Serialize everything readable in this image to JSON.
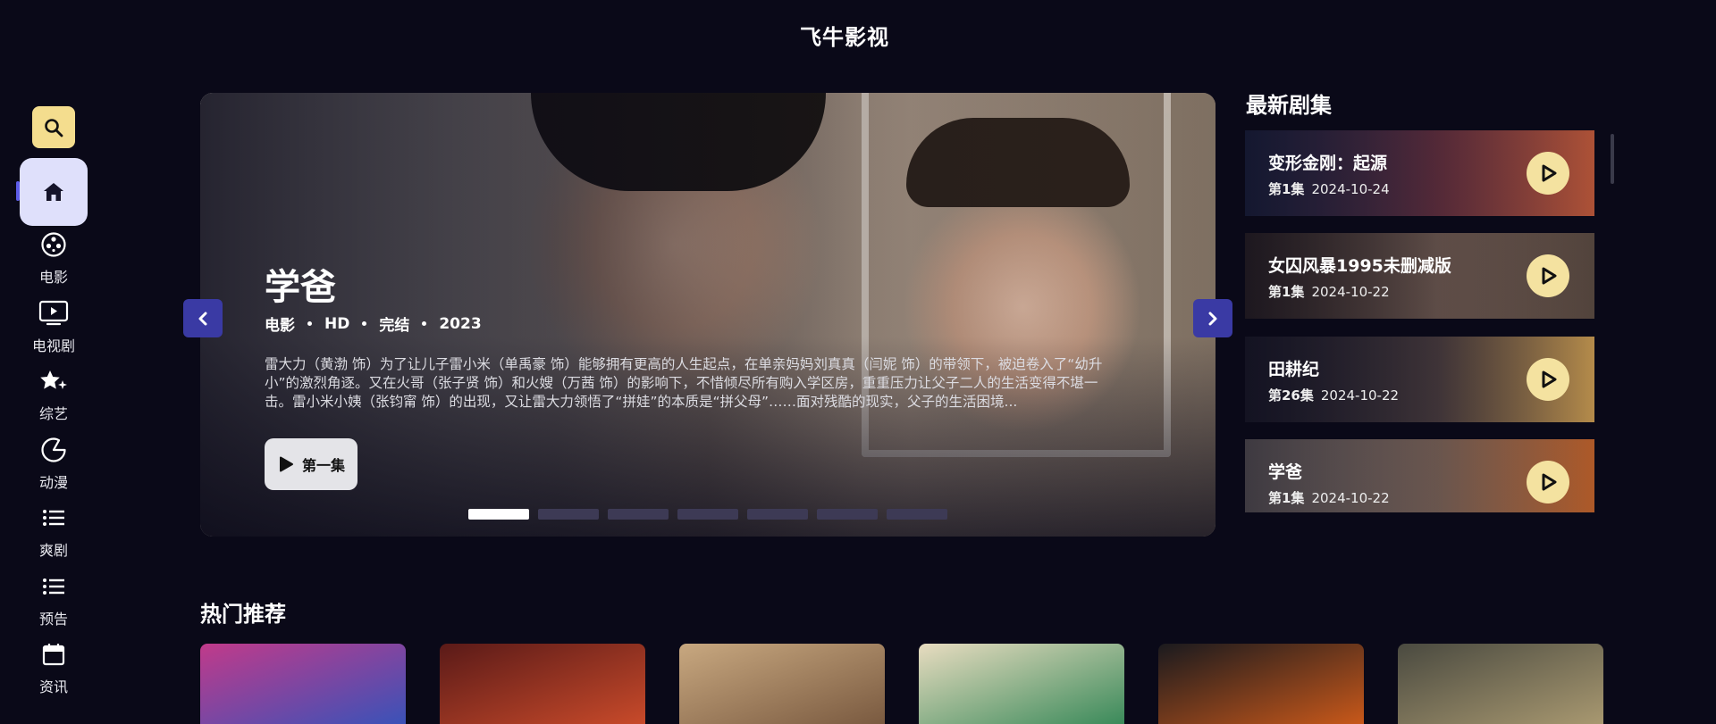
{
  "app": {
    "title": "飞牛影视"
  },
  "sidebar": {
    "search_icon": "search-icon",
    "items": [
      {
        "id": "home",
        "label": "",
        "icon": "home-icon",
        "active": true
      },
      {
        "id": "movie",
        "label": "电影",
        "icon": "film-reel-icon"
      },
      {
        "id": "tv",
        "label": "电视剧",
        "icon": "tv-icon"
      },
      {
        "id": "variety",
        "label": "综艺",
        "icon": "star-sparkle-icon"
      },
      {
        "id": "anime",
        "label": "动漫",
        "icon": "pacman-icon"
      },
      {
        "id": "short",
        "label": "爽剧",
        "icon": "list-icon"
      },
      {
        "id": "trailer",
        "label": "预告",
        "icon": "list-icon"
      },
      {
        "id": "news",
        "label": "资讯",
        "icon": "calendar-icon"
      }
    ]
  },
  "hero": {
    "title": "学爸",
    "meta": [
      "电影",
      "HD",
      "完结",
      "2023"
    ],
    "description": "雷大力（黄渤 饰）为了让儿子雷小米（单禹豪 饰）能够拥有更高的人生起点，在单亲妈妈刘真真（闫妮 饰）的带领下，被迫卷入了“幼升小”的激烈角逐。又在火哥（张子贤 饰）和火嫂（万茜 饰）的影响下，不惜倾尽所有购入学区房，重重压力让父子二人的生活变得不堪一击。雷小米小姨（张钧甯 饰）的出现，又让雷大力领悟了“拼娃”的本质是“拼父母”……面对残酷的现实，父子的生活困境...",
    "play_label": "第一集",
    "slides_total": 7,
    "active_slide": 1
  },
  "latest": {
    "title": "最新剧集",
    "items": [
      {
        "title": "变形金刚：起源",
        "episode": "第1集",
        "date": "2024-10-24",
        "colors": [
          "#2c3a68",
          "#7a3a48",
          "#c05a3a"
        ]
      },
      {
        "title": "女囚风暴1995未删减版",
        "episode": "第1集",
        "date": "2024-10-22",
        "colors": [
          "#4a3a30",
          "#8a7060",
          "#5a4a40"
        ]
      },
      {
        "title": "田耕纪",
        "episode": "第26集",
        "date": "2024-10-22",
        "colors": [
          "#2a2a3a",
          "#5a4a48",
          "#c89a50"
        ]
      },
      {
        "title": "学爸",
        "episode": "第1集",
        "date": "2024-10-22",
        "colors": [
          "#b8aca0",
          "#9c7e6a",
          "#c0622a"
        ]
      }
    ]
  },
  "hot": {
    "title": "热门推荐",
    "posters": [
      {
        "colors": [
          "#c13a8a",
          "#3a52b8"
        ]
      },
      {
        "colors": [
          "#5a1a18",
          "#c84a2a"
        ]
      },
      {
        "colors": [
          "#c8a880",
          "#7a5a40"
        ]
      },
      {
        "colors": [
          "#e8dcc0",
          "#3a8a5a"
        ]
      },
      {
        "colors": [
          "#1a1a1e",
          "#c8581a"
        ]
      },
      {
        "colors": [
          "#4a4a40",
          "#a89870"
        ]
      }
    ]
  }
}
